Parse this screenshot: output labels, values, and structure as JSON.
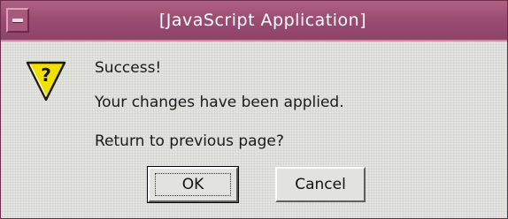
{
  "window": {
    "title": "[JavaScript Application]"
  },
  "dialog": {
    "icon": "question-mark-icon",
    "heading": "Success!",
    "message": "Your changes have been applied.",
    "question": "Return to previous page?"
  },
  "buttons": {
    "ok_label": "OK",
    "cancel_label": "Cancel"
  },
  "colors": {
    "titlebar": "#9d4f74",
    "title_text": "#ffffff",
    "window_bg": "#e4e4e0",
    "icon_yellow": "#f2e000"
  }
}
